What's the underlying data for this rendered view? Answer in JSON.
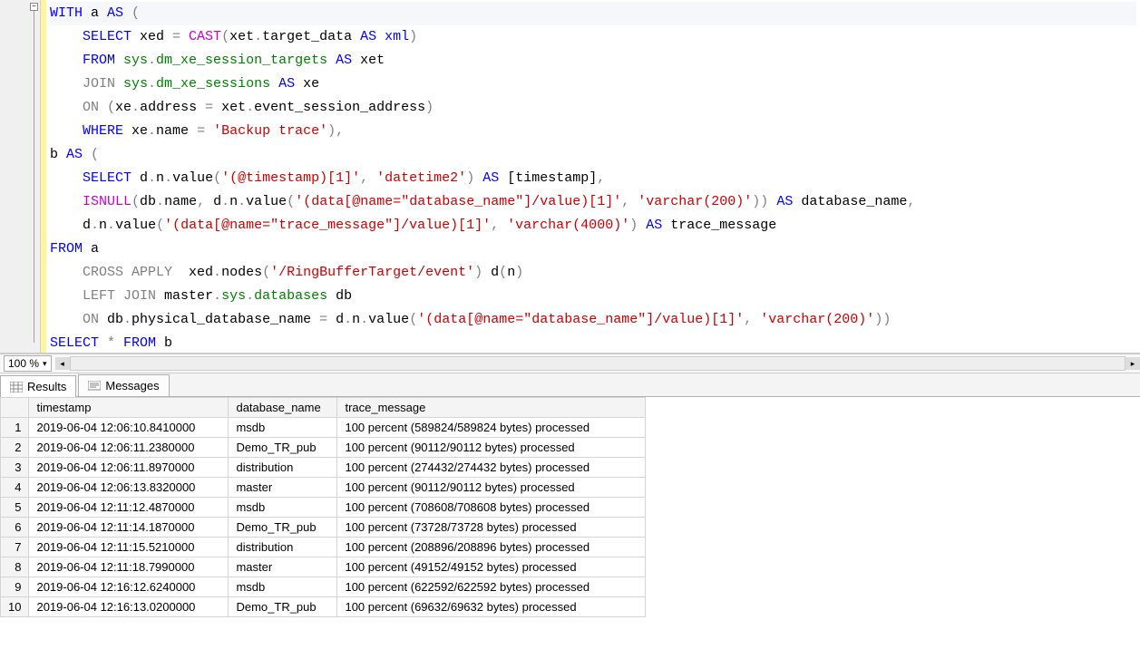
{
  "zoom": "100 %",
  "tabs": {
    "results": "Results",
    "messages": "Messages"
  },
  "sql": {
    "l1a": "WITH",
    "l1b": " a ",
    "l1c": "AS ",
    "l1d": "(",
    "l2a": "    SELECT",
    "l2b": " xed ",
    "l2c": "= ",
    "l2d": "CAST",
    "l2e": "(",
    "l2f": "xet",
    "l2g": ".",
    "l2h": "target_data ",
    "l2i": "AS ",
    "l2j": "xml",
    "l2k": ")",
    "l3a": "    FROM ",
    "l3b": "sys",
    "l3c": ".",
    "l3d": "dm_xe_session_targets ",
    "l3e": "AS",
    "l3f": " xet",
    "l4a": "    JOIN ",
    "l4b": "sys",
    "l4c": ".",
    "l4d": "dm_xe_sessions ",
    "l4e": "AS",
    "l4f": " xe",
    "l5a": "    ON ",
    "l5b": "(",
    "l5c": "xe",
    "l5d": ".",
    "l5e": "address ",
    "l5f": "= ",
    "l5g": "xet",
    "l5h": ".",
    "l5i": "event_session_address",
    "l5j": ")",
    "l6a": "    WHERE",
    "l6b": " xe",
    "l6c": ".",
    "l6d": "name ",
    "l6e": "= ",
    "l6f": "'Backup trace'",
    "l6g": "),",
    "l7a": "b ",
    "l7b": "AS ",
    "l7c": "(",
    "l8a": "    SELECT",
    "l8b": " d",
    "l8c": ".",
    "l8d": "n",
    "l8e": ".",
    "l8f": "value",
    "l8g": "(",
    "l8h": "'(@timestamp)[1]'",
    "l8i": ", ",
    "l8j": "'datetime2'",
    "l8k": ") ",
    "l8l": "AS",
    "l8m": " [timestamp]",
    "l8n": ",",
    "l9a": "    ISNULL",
    "l9b": "(",
    "l9c": "db",
    "l9d": ".",
    "l9e": "name",
    "l9f": ", ",
    "l9g": "d",
    "l9h": ".",
    "l9i": "n",
    "l9j": ".",
    "l9k": "value",
    "l9l": "(",
    "l9m": "'(data[@name=\"database_name\"]/value)[1]'",
    "l9n": ", ",
    "l9o": "'varchar(200)'",
    "l9p": ")) ",
    "l9q": "AS",
    "l9r": " database_name",
    "l9s": ",",
    "l10a": "    d",
    "l10b": ".",
    "l10c": "n",
    "l10d": ".",
    "l10e": "value",
    "l10f": "(",
    "l10g": "'(data[@name=\"trace_message\"]/value)[1]'",
    "l10h": ", ",
    "l10i": "'varchar(4000)'",
    "l10j": ") ",
    "l10k": "AS",
    "l10l": " trace_message",
    "l11a": "FROM",
    "l11b": " a",
    "l12a": "    CROSS APPLY",
    "l12b": "  xed",
    "l12c": ".",
    "l12d": "nodes",
    "l12e": "(",
    "l12f": "'/RingBufferTarget/event'",
    "l12g": ") ",
    "l12h": "d",
    "l12i": "(",
    "l12j": "n",
    "l12k": ")",
    "l13a": "    LEFT JOIN ",
    "l13b": "master",
    "l13c": ".",
    "l13d": "sys",
    "l13e": ".",
    "l13f": "databases",
    "l13g": " db",
    "l14a": "    ON",
    "l14b": " db",
    "l14c": ".",
    "l14d": "physical_database_name ",
    "l14e": "= ",
    "l14f": "d",
    "l14g": ".",
    "l14h": "n",
    "l14i": ".",
    "l14j": "value",
    "l14k": "(",
    "l14l": "'(data[@name=\"database_name\"]/value)[1]'",
    "l14m": ", ",
    "l14n": "'varchar(200)'",
    "l14o": "))",
    "l15a": "SELECT ",
    "l15b": "* ",
    "l15c": "FROM",
    "l15d": " b"
  },
  "grid": {
    "columns": [
      "timestamp",
      "database_name",
      "trace_message"
    ],
    "rows": [
      {
        "n": "1",
        "ts": "2019-06-04 12:06:10.8410000",
        "db": "msdb",
        "msg": "100 percent (589824/589824 bytes) processed"
      },
      {
        "n": "2",
        "ts": "2019-06-04 12:06:11.2380000",
        "db": "Demo_TR_pub",
        "msg": "100 percent (90112/90112 bytes) processed"
      },
      {
        "n": "3",
        "ts": "2019-06-04 12:06:11.8970000",
        "db": "distribution",
        "msg": "100 percent (274432/274432 bytes) processed"
      },
      {
        "n": "4",
        "ts": "2019-06-04 12:06:13.8320000",
        "db": "master",
        "msg": "100 percent (90112/90112 bytes) processed"
      },
      {
        "n": "5",
        "ts": "2019-06-04 12:11:12.4870000",
        "db": "msdb",
        "msg": "100 percent (708608/708608 bytes) processed"
      },
      {
        "n": "6",
        "ts": "2019-06-04 12:11:14.1870000",
        "db": "Demo_TR_pub",
        "msg": "100 percent (73728/73728 bytes) processed"
      },
      {
        "n": "7",
        "ts": "2019-06-04 12:11:15.5210000",
        "db": "distribution",
        "msg": "100 percent (208896/208896 bytes) processed"
      },
      {
        "n": "8",
        "ts": "2019-06-04 12:11:18.7990000",
        "db": "master",
        "msg": "100 percent (49152/49152 bytes) processed"
      },
      {
        "n": "9",
        "ts": "2019-06-04 12:16:12.6240000",
        "db": "msdb",
        "msg": "100 percent (622592/622592 bytes) processed"
      },
      {
        "n": "10",
        "ts": "2019-06-04 12:16:13.0200000",
        "db": "Demo_TR_pub",
        "msg": "100 percent (69632/69632 bytes) processed"
      }
    ]
  }
}
